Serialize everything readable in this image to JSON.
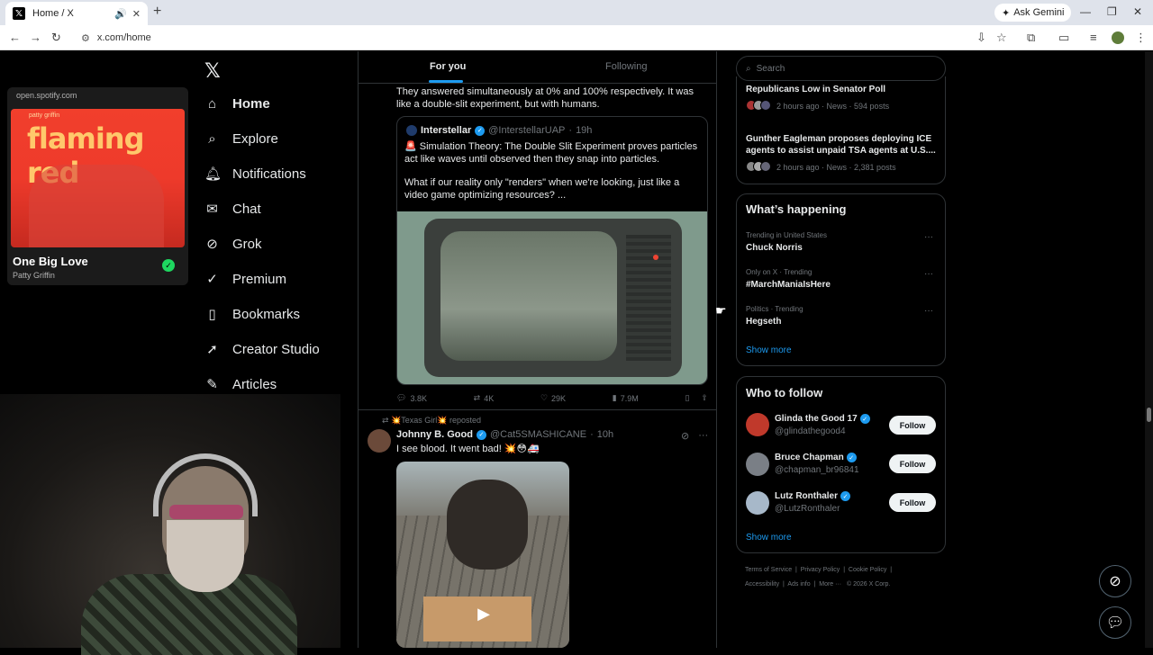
{
  "browser": {
    "tab_title": "Home / X",
    "tab_icon": "x-logo-icon",
    "url": "x.com/home",
    "ask_gemini": "Ask Gemini"
  },
  "spotify": {
    "domain": "open.spotify.com",
    "artist_art": "patty griffin",
    "album_art_title": "flaming red",
    "song": "One Big Love",
    "artist": "Patty Griffin"
  },
  "nav": {
    "items": [
      {
        "label": "Home",
        "icon": "home-icon"
      },
      {
        "label": "Explore",
        "icon": "search-icon"
      },
      {
        "label": "Notifications",
        "icon": "bell-icon"
      },
      {
        "label": "Chat",
        "icon": "mail-icon"
      },
      {
        "label": "Grok",
        "icon": "grok-icon"
      },
      {
        "label": "Premium",
        "icon": "verified-icon"
      },
      {
        "label": "Bookmarks",
        "icon": "bookmark-icon"
      },
      {
        "label": "Creator Studio",
        "icon": "rocket-icon"
      },
      {
        "label": "Articles",
        "icon": "article-icon"
      }
    ]
  },
  "feed": {
    "tabs": {
      "for_you": "For you",
      "following": "Following"
    },
    "post1": {
      "text": "They answered simultaneously at 0% and 100% respectively. It was like a double-slit experiment, but with humans.",
      "quote": {
        "name": "Interstellar",
        "handle": "@InterstellarUAP",
        "time": "19h",
        "text1": "🚨 Simulation Theory:  The Double Slit Experiment proves particles act like waves until observed then they snap into particles.",
        "text2": "What if our reality only \"renders\" when we're looking, just like a video game optimizing resources?  ..."
      },
      "actions": {
        "replies": "3.8K",
        "reposts": "4K",
        "likes": "29K",
        "views": "7.9M"
      }
    },
    "post2": {
      "repost_label": "💥Texas Girl💥 reposted",
      "name": "Johnny B. Good",
      "handle": "@Cat5SMASHICANE",
      "time": "10h",
      "text": "I see blood. It went bad! 💥😳🚑"
    }
  },
  "right": {
    "search_placeholder": "Search",
    "news": [
      {
        "headline": "Republicans Low in Senator Poll",
        "meta": "2 hours ago · News · 594 posts"
      },
      {
        "headline": "Gunther Eagleman proposes deploying ICE agents to assist unpaid TSA agents at U.S....",
        "meta": "2 hours ago · News · 2,381 posts"
      }
    ],
    "happening_title": "What’s happening",
    "trends": [
      {
        "category": "Trending in United States",
        "name": "Chuck Norris"
      },
      {
        "category": "Only on X · Trending",
        "name": "#MarchManiaIsHere"
      },
      {
        "category": "Politics · Trending",
        "name": "Hegseth"
      }
    ],
    "show_more": "Show more",
    "who_title": "Who to follow",
    "follow": [
      {
        "name": "Glinda the Good 17",
        "handle": "@glindathegood4",
        "color": "#c0392b"
      },
      {
        "name": "Bruce Chapman",
        "handle": "@chapman_br96841",
        "color": "#7a7f86"
      },
      {
        "name": "Lutz Ronthaler",
        "handle": "@LutzRonthaler",
        "color": "#a7b8c9"
      }
    ],
    "follow_label": "Follow",
    "footer1": [
      "Terms of Service",
      "Privacy Policy",
      "Cookie Policy"
    ],
    "footer2": [
      "Accessibility",
      "Ads info",
      "More ···",
      "© 2026 X Corp."
    ]
  },
  "colors": {
    "accent": "#1d9bf0",
    "background": "#000000",
    "border": "#2f3336"
  }
}
